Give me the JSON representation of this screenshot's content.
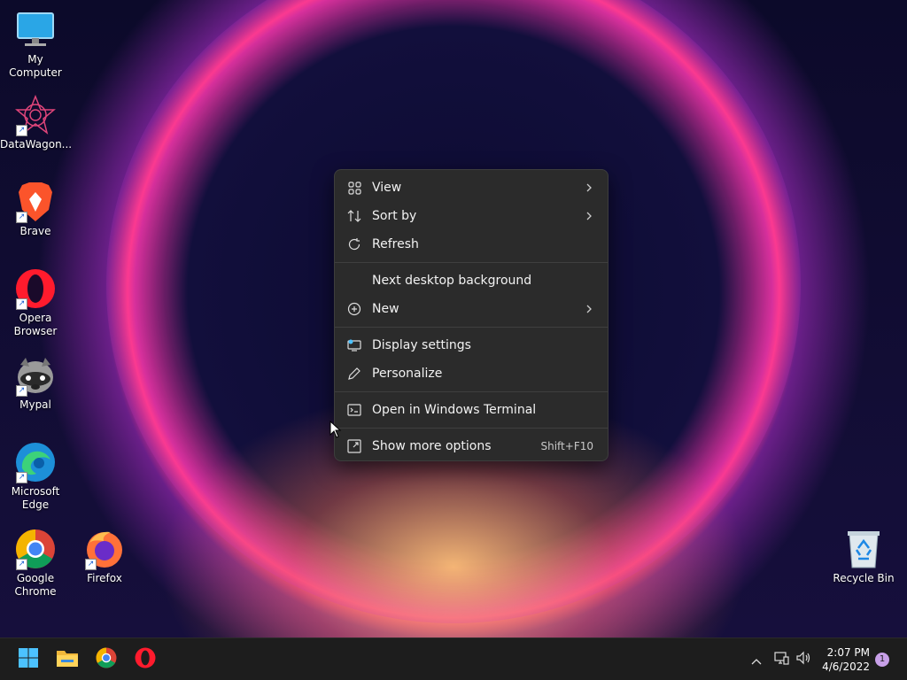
{
  "desktop": {
    "icons": [
      {
        "label": "My Computer",
        "icon": "monitor-icon"
      },
      {
        "label": "DataWagon...",
        "icon": "datawagon-icon"
      },
      {
        "label": "Brave",
        "icon": "brave-icon"
      },
      {
        "label": "Opera Browser",
        "icon": "opera-icon"
      },
      {
        "label": "Mypal",
        "icon": "mypal-icon"
      },
      {
        "label": "Microsoft Edge",
        "icon": "edge-icon"
      },
      {
        "label": "Google Chrome",
        "icon": "chrome-icon"
      },
      {
        "label": "Firefox",
        "icon": "firefox-icon"
      },
      {
        "label": "Recycle Bin",
        "icon": "recycle-bin-icon"
      }
    ]
  },
  "context_menu": {
    "items": [
      {
        "label": "View",
        "icon": "grid-icon",
        "submenu": true
      },
      {
        "label": "Sort by",
        "icon": "sort-icon",
        "submenu": true
      },
      {
        "label": "Refresh",
        "icon": "refresh-icon"
      },
      {
        "label": "Next desktop background",
        "icon": ""
      },
      {
        "label": "New",
        "icon": "plus-circle-icon",
        "submenu": true
      },
      {
        "label": "Display settings",
        "icon": "display-icon"
      },
      {
        "label": "Personalize",
        "icon": "pen-icon"
      },
      {
        "label": "Open in Windows Terminal",
        "icon": "terminal-icon"
      },
      {
        "label": "Show more options",
        "icon": "expand-icon",
        "shortcut": "Shift+F10"
      }
    ]
  },
  "taskbar": {
    "pinned": [
      "start-icon",
      "file-explorer-icon",
      "chrome-icon",
      "opera-icon"
    ],
    "tray": [
      "chevron-up-icon",
      "network-icon",
      "volume-icon"
    ],
    "clock": {
      "time": "2:07 PM",
      "date": "4/6/2022"
    },
    "notification_count": "1"
  },
  "colors": {
    "menu_bg": "#2b2b2b",
    "taskbar_bg": "#1d1d1d",
    "accent": "#ff3a8c"
  }
}
